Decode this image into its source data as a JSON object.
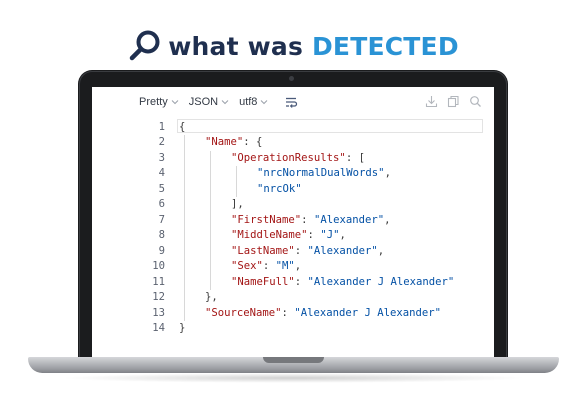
{
  "headline": {
    "word1": "what was",
    "word2": "DETECTED",
    "icon": "search-icon",
    "colors": {
      "dark": "#1f2f4f",
      "accent": "#2a93d5"
    }
  },
  "toolbar": {
    "format": "Pretty",
    "type": "JSON",
    "encoding": "utf8",
    "icons": [
      "word-wrap-icon",
      "download-icon",
      "copy-icon",
      "search-icon"
    ]
  },
  "editor": {
    "line_numbers": [
      "1",
      "2",
      "3",
      "4",
      "5",
      "6",
      "7",
      "8",
      "9",
      "10",
      "11",
      "12",
      "13",
      "14"
    ],
    "lines": [
      {
        "indent": 0,
        "parts": [
          {
            "t": "{",
            "c": "p"
          }
        ]
      },
      {
        "indent": 1,
        "parts": [
          {
            "t": "\"Name\"",
            "c": "key"
          },
          {
            "t": ": {",
            "c": "p"
          }
        ]
      },
      {
        "indent": 2,
        "parts": [
          {
            "t": "\"OperationResults\"",
            "c": "key"
          },
          {
            "t": ": [",
            "c": "p"
          }
        ]
      },
      {
        "indent": 3,
        "parts": [
          {
            "t": "\"nrcNormalDualWords\"",
            "c": "str"
          },
          {
            "t": ",",
            "c": "p"
          }
        ]
      },
      {
        "indent": 3,
        "parts": [
          {
            "t": "\"nrcOk\"",
            "c": "str"
          }
        ]
      },
      {
        "indent": 2,
        "parts": [
          {
            "t": "],",
            "c": "p"
          }
        ]
      },
      {
        "indent": 2,
        "parts": [
          {
            "t": "\"FirstName\"",
            "c": "key"
          },
          {
            "t": ": ",
            "c": "p"
          },
          {
            "t": "\"Alexander\"",
            "c": "str"
          },
          {
            "t": ",",
            "c": "p"
          }
        ]
      },
      {
        "indent": 2,
        "parts": [
          {
            "t": "\"MiddleName\"",
            "c": "key"
          },
          {
            "t": ": ",
            "c": "p"
          },
          {
            "t": "\"J\"",
            "c": "str"
          },
          {
            "t": ",",
            "c": "p"
          }
        ]
      },
      {
        "indent": 2,
        "parts": [
          {
            "t": "\"LastName\"",
            "c": "key"
          },
          {
            "t": ": ",
            "c": "p"
          },
          {
            "t": "\"Alexander\"",
            "c": "str"
          },
          {
            "t": ",",
            "c": "p"
          }
        ]
      },
      {
        "indent": 2,
        "parts": [
          {
            "t": "\"Sex\"",
            "c": "key"
          },
          {
            "t": ": ",
            "c": "p"
          },
          {
            "t": "\"M\"",
            "c": "str"
          },
          {
            "t": ",",
            "c": "p"
          }
        ]
      },
      {
        "indent": 2,
        "parts": [
          {
            "t": "\"NameFull\"",
            "c": "key"
          },
          {
            "t": ": ",
            "c": "p"
          },
          {
            "t": "\"Alexander J Alexander\"",
            "c": "str"
          }
        ]
      },
      {
        "indent": 1,
        "parts": [
          {
            "t": "},",
            "c": "p"
          }
        ]
      },
      {
        "indent": 1,
        "parts": [
          {
            "t": "\"SourceName\"",
            "c": "key"
          },
          {
            "t": ": ",
            "c": "p"
          },
          {
            "t": "\"Alexander J Alexander\"",
            "c": "str"
          }
        ]
      },
      {
        "indent": 0,
        "parts": [
          {
            "t": "}",
            "c": "p"
          }
        ]
      }
    ]
  }
}
